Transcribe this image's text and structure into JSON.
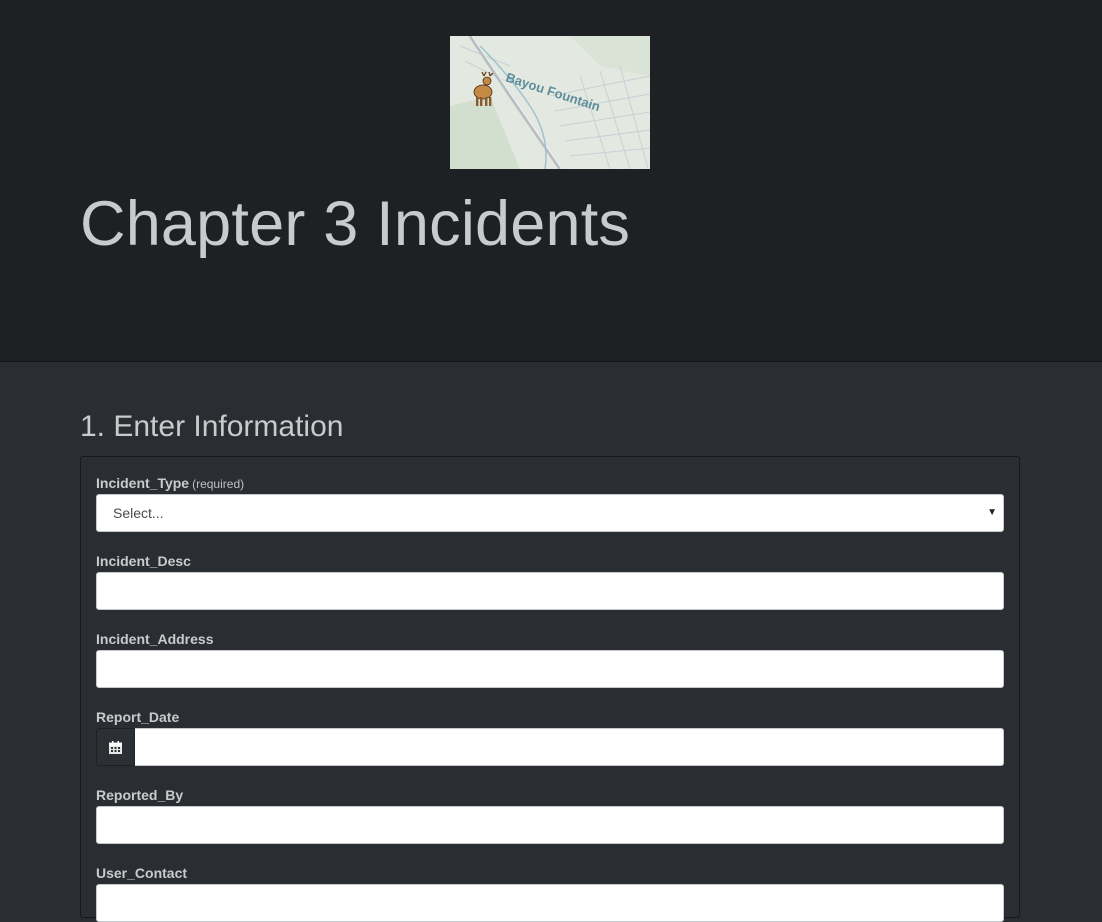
{
  "header": {
    "title": "Chapter 3 Incidents",
    "map_thumbnail": {
      "map_label": "Bayou Fountain",
      "icon": "deer-icon"
    }
  },
  "section": {
    "title": "1. Enter Information"
  },
  "form": {
    "incident_type": {
      "label": "Incident_Type",
      "hint": "(required)",
      "selected": "Select..."
    },
    "incident_desc": {
      "label": "Incident_Desc",
      "value": ""
    },
    "incident_address": {
      "label": "Incident_Address",
      "value": ""
    },
    "report_date": {
      "label": "Report_Date",
      "value": "",
      "icon": "calendar-icon"
    },
    "reported_by": {
      "label": "Reported_By",
      "value": ""
    },
    "user_contact": {
      "label": "User_Contact",
      "value": ""
    }
  },
  "colors": {
    "header_bg": "#1f2024",
    "page_bg": "#2a2e33",
    "text": "#c9cacc"
  }
}
